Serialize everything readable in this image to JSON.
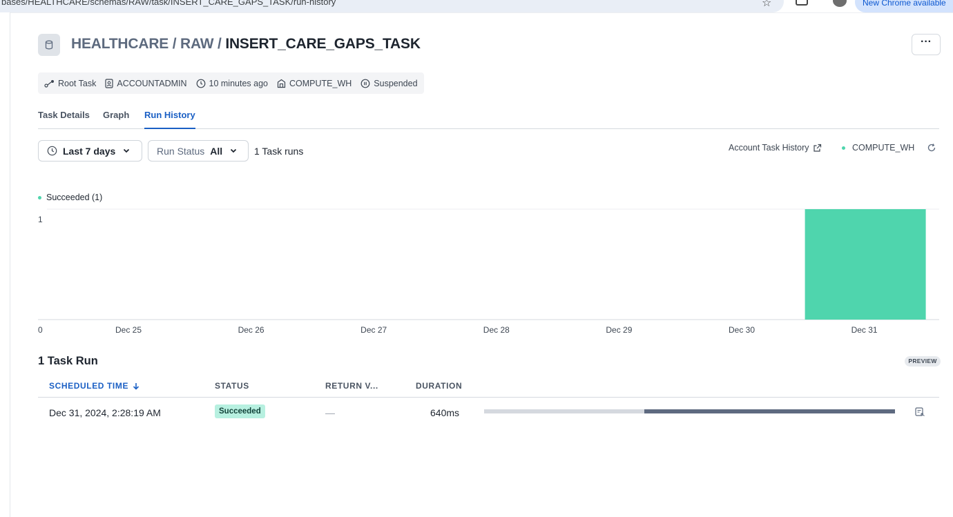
{
  "browser": {
    "url": "bases/HEALTHCARE/schemas/RAW/task/INSERT_CARE_GAPS_TASK/run-history",
    "notice": "New Chrome available"
  },
  "header": {
    "breadcrumb_db": "HEALTHCARE",
    "breadcrumb_sep1": " / ",
    "breadcrumb_schema": "RAW",
    "breadcrumb_sep2": " / ",
    "task_name": "INSERT_CARE_GAPS_TASK",
    "more_label": "···"
  },
  "meta": {
    "task_type": "Root Task",
    "owner": "ACCOUNTADMIN",
    "updated": "10 minutes ago",
    "warehouse": "COMPUTE_WH",
    "state": "Suspended"
  },
  "tabs": [
    {
      "label": "Task Details",
      "active": false
    },
    {
      "label": "Graph",
      "active": false
    },
    {
      "label": "Run History",
      "active": true
    }
  ],
  "filters": {
    "range_label": "Last 7 days",
    "status_label": "Run Status",
    "status_value": "All",
    "runs_count": "1 Task runs"
  },
  "toolbar_right": {
    "account_history": "Account Task History",
    "warehouse": "COMPUTE_WH"
  },
  "chart_data": {
    "type": "bar",
    "categories": [
      "Dec 25",
      "Dec 26",
      "Dec 27",
      "Dec 28",
      "Dec 29",
      "Dec 30",
      "Dec 31"
    ],
    "series": [
      {
        "name": "Succeeded (1)",
        "values": [
          0,
          0,
          0,
          0,
          0,
          0,
          1
        ]
      }
    ],
    "legend": [
      "Succeeded (1)"
    ],
    "y_ticks": [
      "0",
      "1"
    ],
    "ylim": [
      0,
      1
    ],
    "colors": {
      "succeeded": "#4fd5ad"
    },
    "grid": false,
    "legend_position": "top-left"
  },
  "runs_table": {
    "heading": "1 Task Run",
    "badge": "PREVIEW",
    "columns": [
      "SCHEDULED TIME",
      "STATUS",
      "RETURN V...",
      "DURATION"
    ],
    "rows": [
      {
        "scheduled_time": "Dec 31, 2024, 2:28:19 AM",
        "status": "Succeeded",
        "return_value": "—",
        "duration": "640ms",
        "timeline_queued_fraction": 0.39,
        "timeline_run_fraction": 0.61
      }
    ]
  }
}
